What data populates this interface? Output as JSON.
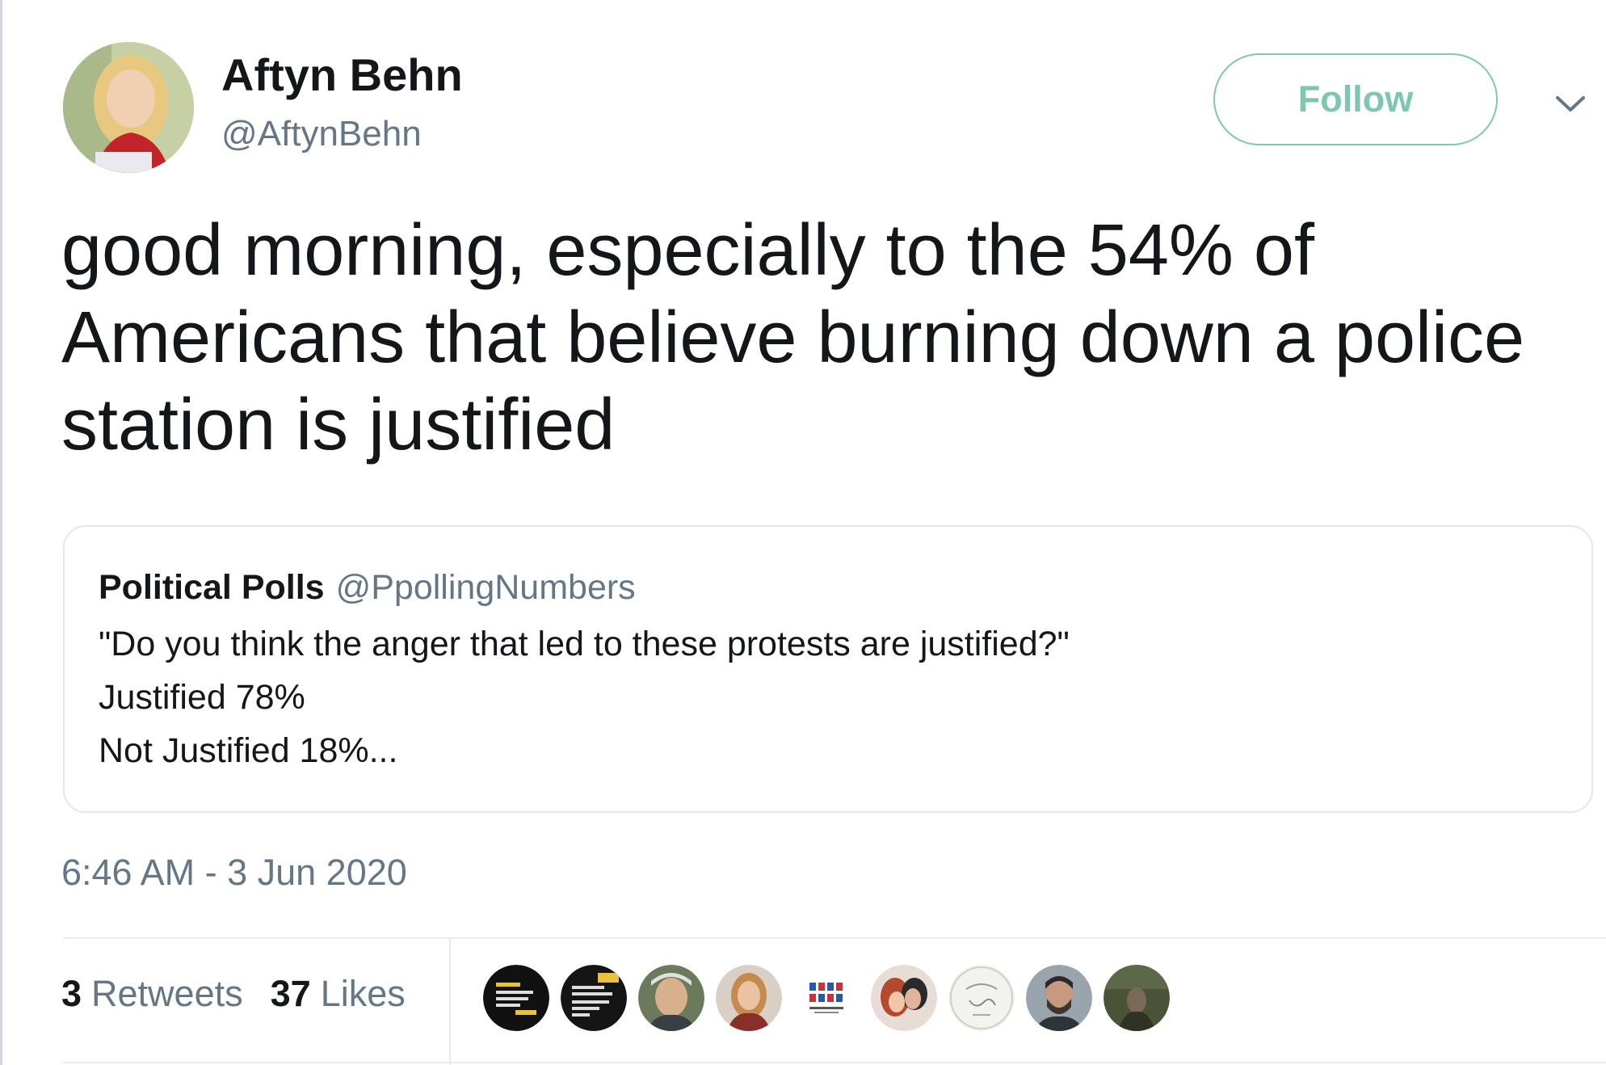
{
  "author": {
    "display_name": "Aftyn Behn",
    "handle": "@AftynBehn",
    "avatar_icon": "profile-photo-avatar"
  },
  "actions": {
    "follow_label": "Follow",
    "more_icon": "chevron-down-icon"
  },
  "tweet": {
    "text_lines": [
      "good morning, especially to the 54% of",
      "Americans that believe burning down a police",
      "station is justified"
    ],
    "timestamp": "6:46 AM - 3 Jun 2020"
  },
  "quoted_tweet": {
    "author_name": "Political Polls",
    "author_handle": "@PpollingNumbers",
    "lines": [
      "\"Do you think the anger that led to these protests are justified?\"",
      "Justified 78%",
      "Not Justified 18%..."
    ]
  },
  "stats": {
    "retweets_count": "3",
    "retweets_label": "Retweets",
    "likes_count": "37",
    "likes_label": "Likes"
  },
  "likers": [
    {
      "icon": "in-defense-of-black-life-avatar"
    },
    {
      "icon": "in-defense-of-black-life-avatar"
    },
    {
      "icon": "person-avatar"
    },
    {
      "icon": "person-avatar"
    },
    {
      "icon": "logo-avatar"
    },
    {
      "icon": "people-avatar"
    },
    {
      "icon": "sketch-avatar"
    },
    {
      "icon": "person-avatar"
    },
    {
      "icon": "outdoor-avatar"
    }
  ],
  "colors": {
    "follow_accent": "#7cc7ae",
    "secondary_text": "#657786",
    "primary_text": "#14171a",
    "border": "#e1e8ed"
  }
}
